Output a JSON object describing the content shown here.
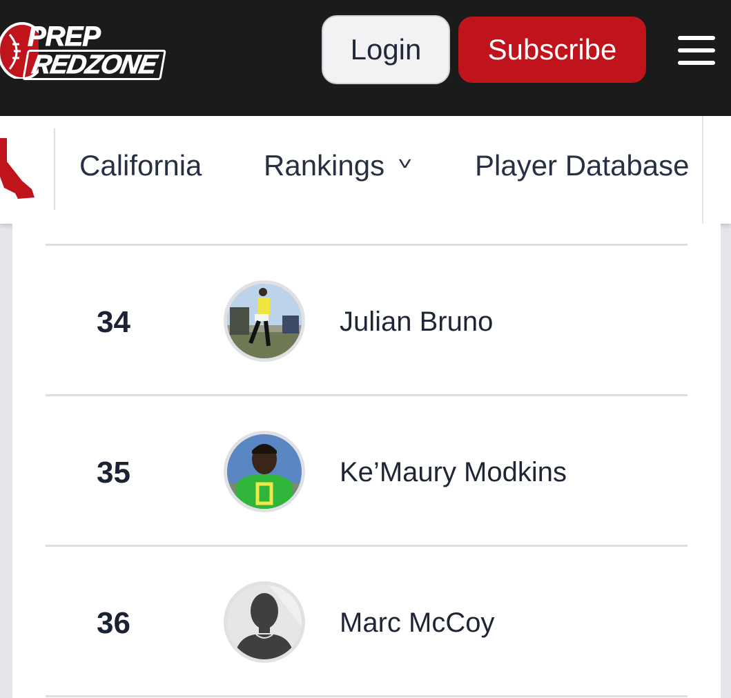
{
  "header": {
    "logo": {
      "line1": "PREP",
      "line2": "REDZONE"
    },
    "login_label": "Login",
    "subscribe_label": "Subscribe",
    "menu_icon": "hamburger-menu-icon"
  },
  "nav": {
    "state_icon": "california-state-icon",
    "items": [
      {
        "label": "California"
      },
      {
        "label": "Rankings",
        "icon": "chevron-down-icon"
      },
      {
        "label": "Player Database"
      }
    ]
  },
  "rankings": [
    {
      "rank": "34",
      "name": "Julian Bruno",
      "avatar": "player-photo"
    },
    {
      "rank": "35",
      "name": "Ke’Maury Modkins",
      "avatar": "player-photo"
    },
    {
      "rank": "36",
      "name": "Marc McCoy",
      "avatar": "default-avatar-icon"
    }
  ],
  "colors": {
    "header_bg": "#1b1b1b",
    "brand_red": "#c0141c",
    "text_dark": "#1e2535"
  }
}
